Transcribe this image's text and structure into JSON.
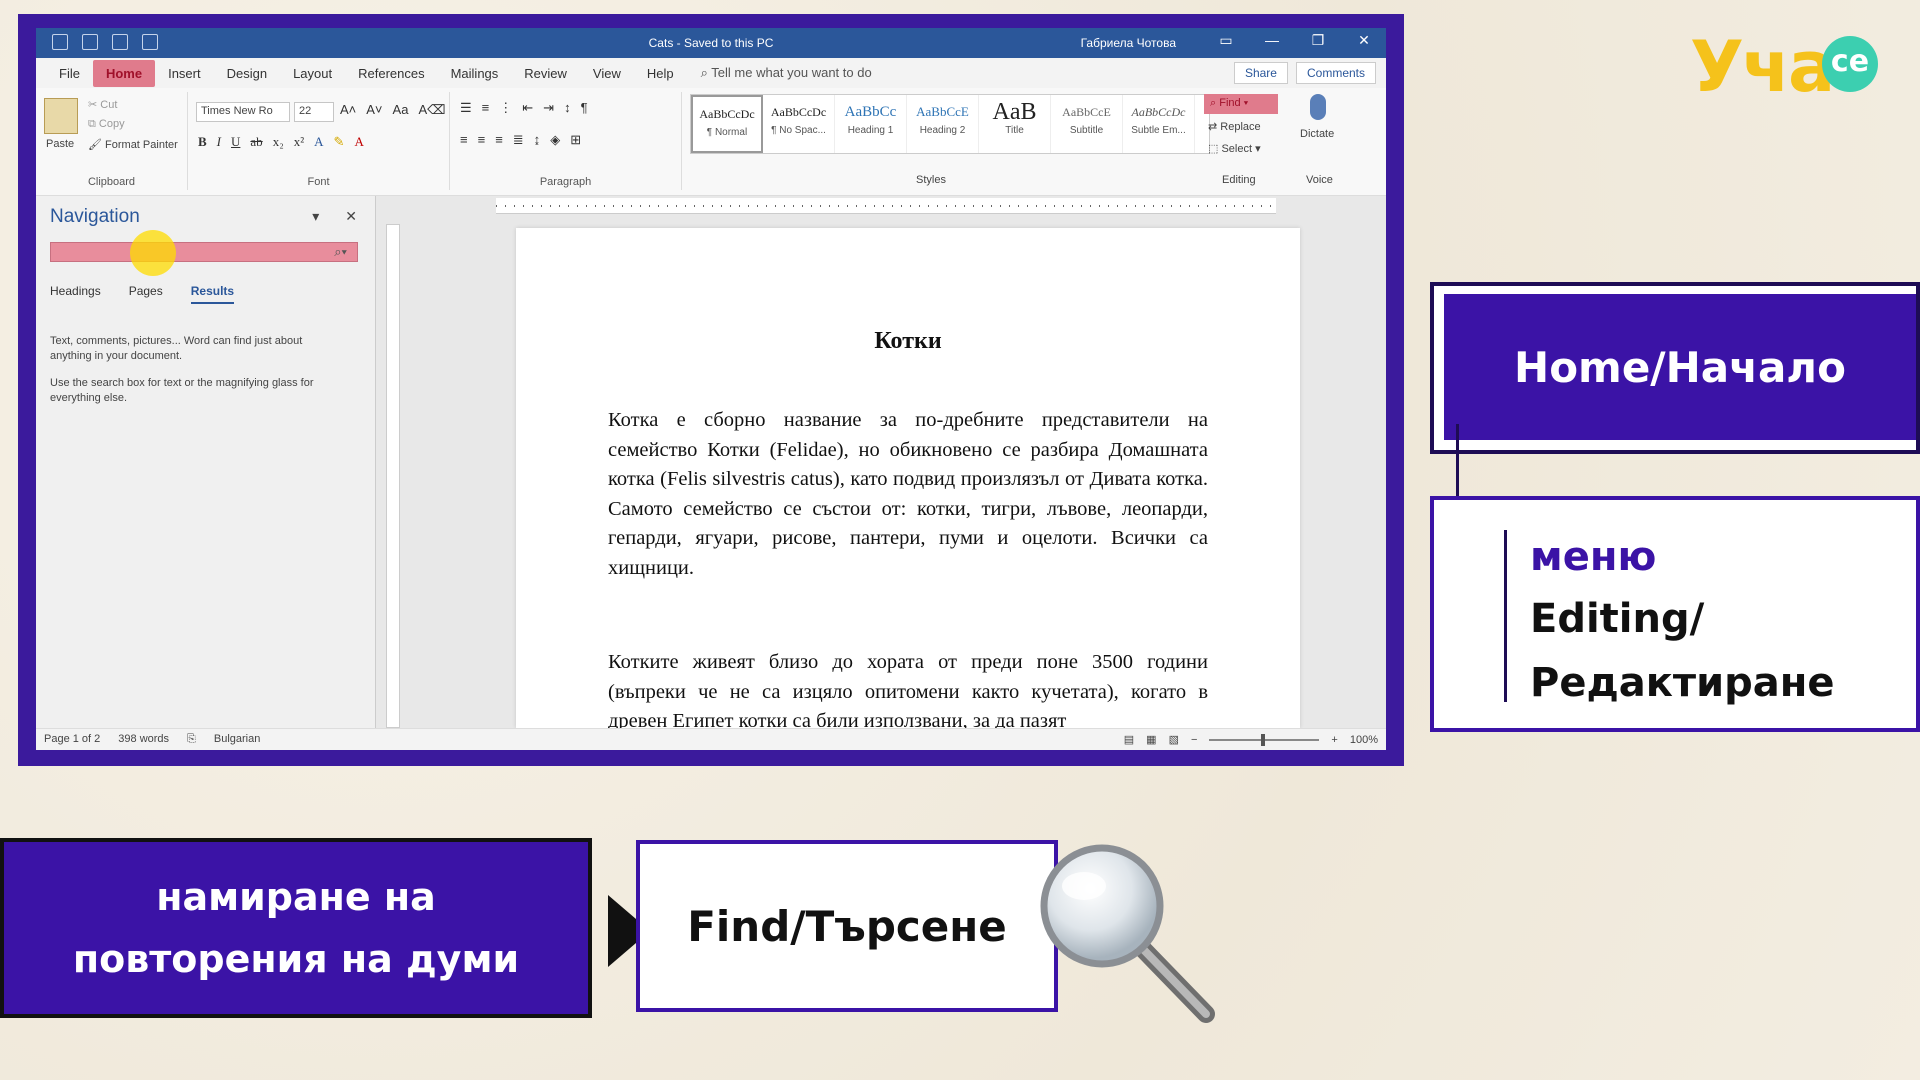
{
  "word": {
    "title": "Cats - Saved to this PC",
    "user": "Габриела Чотова",
    "tabs": [
      "File",
      "Home",
      "Insert",
      "Design",
      "Layout",
      "References",
      "Mailings",
      "Review",
      "View",
      "Help"
    ],
    "active_tab": "Home",
    "tell_me": "Tell me what you want to do",
    "share": "Share",
    "comments": "Comments",
    "ribbon": {
      "clipboard": {
        "label": "Clipboard",
        "paste": "Paste",
        "cut": "Cut",
        "copy": "Copy",
        "format_painter": "Format Painter"
      },
      "font": {
        "label": "Font",
        "name": "Times New Ro",
        "size": "22"
      },
      "paragraph": {
        "label": "Paragraph"
      },
      "styles": {
        "label": "Styles",
        "items": [
          {
            "sample": "AaBbCcDc",
            "name": "¶ Normal"
          },
          {
            "sample": "AaBbCcDc",
            "name": "¶ No Spac..."
          },
          {
            "sample": "AaBbCc",
            "name": "Heading 1"
          },
          {
            "sample": "AaBbCcE",
            "name": "Heading 2"
          },
          {
            "sample": "AaB",
            "name": "Title"
          },
          {
            "sample": "AaBbCcE",
            "name": "Subtitle"
          },
          {
            "sample": "AaBbCcDc",
            "name": "Subtle Em..."
          }
        ]
      },
      "editing": {
        "label": "Editing",
        "find": "Find",
        "replace": "Replace",
        "select": "Select"
      },
      "voice": {
        "label": "Voice",
        "dictate": "Dictate"
      }
    },
    "navigation": {
      "title": "Navigation",
      "tabs": [
        "Headings",
        "Pages",
        "Results"
      ],
      "active_tab": "Results",
      "info1": "Text, comments, pictures... Word can find just about anything in your document.",
      "info2": "Use the search box for text or the magnifying glass for everything else."
    },
    "document": {
      "heading": "Котки",
      "para1": "Котка е сборно название за по-дребните представители на семейство Котки (Felidae), но обикновено се разбира Домашната котка (Felis silvestris catus), като подвид произлязъл от Дивата котка. Самото семейство се състои от: котки, тигри, лъвове, леопарди, гепарди, ягуари, рисове, пантери, пуми и оцелоти. Всички са хищници.",
      "para2": "Котките живеят близо до хората от преди поне 3500 години (въпреки че не са изцяло опитомени както кучетата), когато в древен Египет котки са били използвани, за да пазят"
    },
    "status": {
      "page": "Page 1 of 2",
      "words": "398 words",
      "language": "Bulgarian",
      "zoom": "100%"
    }
  },
  "overlay": {
    "logo_text": "Уча",
    "logo_badge": "се",
    "home_label": "Home/Начало",
    "menu_line1": "меню",
    "menu_line2": "Editing/",
    "menu_line3": "Редактиране",
    "find_desc_line1": "намиране на",
    "find_desc_line2": "повторения на думи",
    "find_label": "Find/Търсене"
  }
}
